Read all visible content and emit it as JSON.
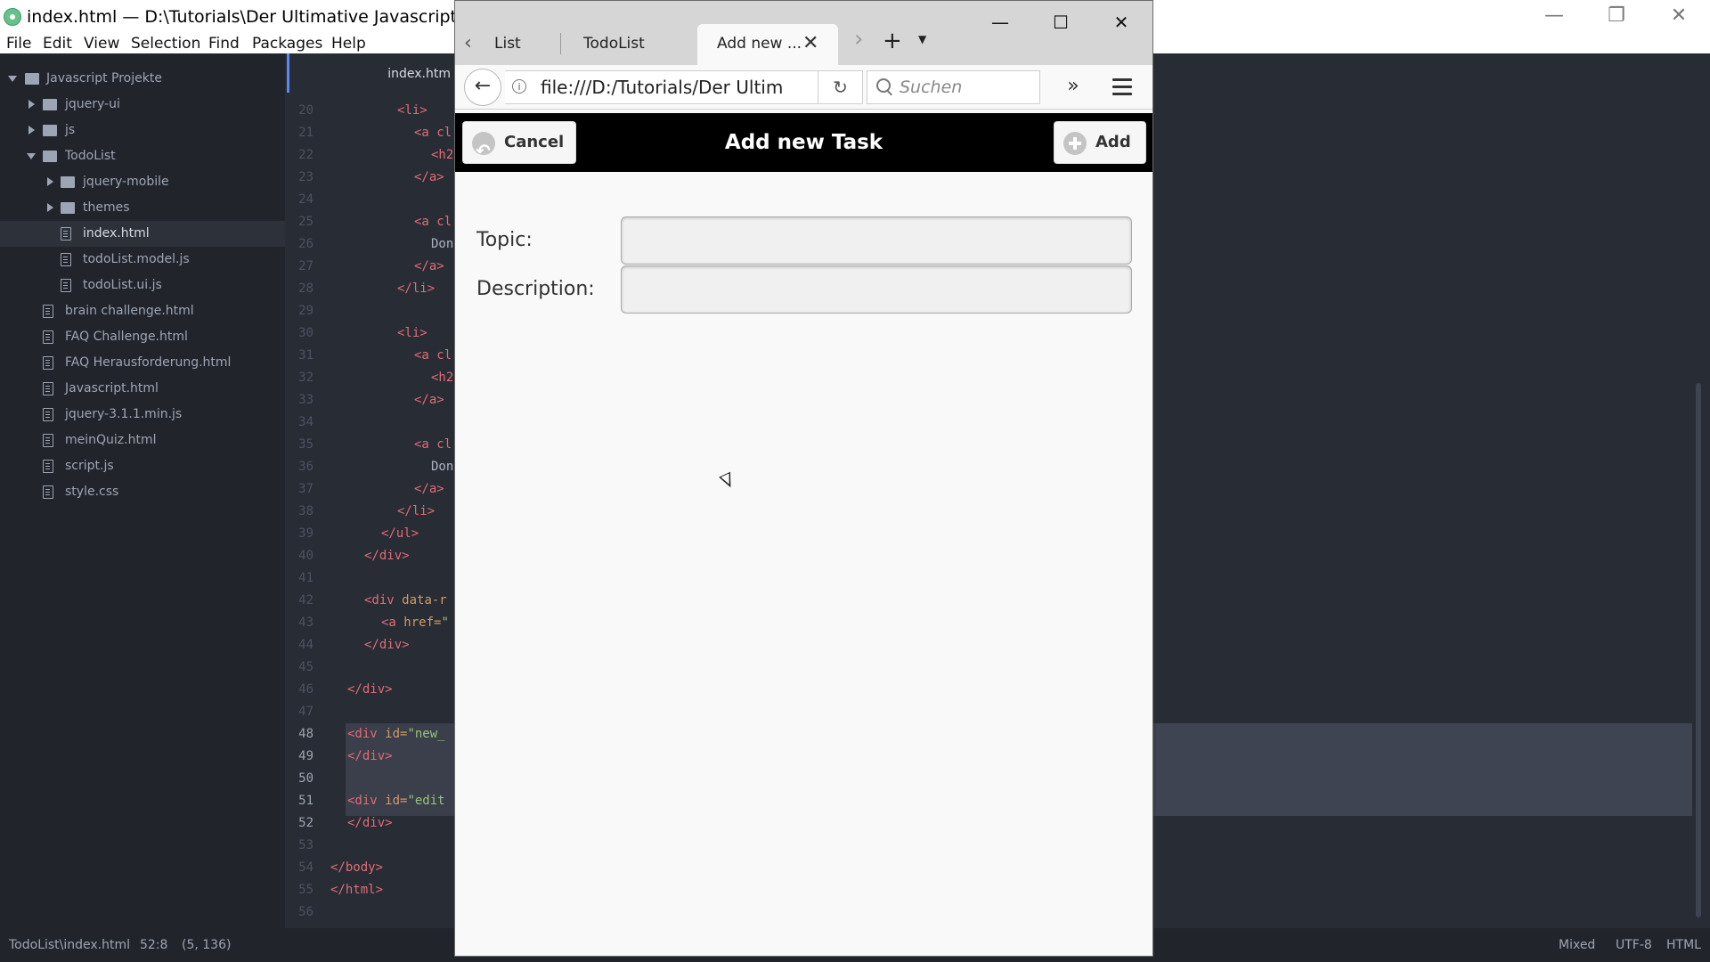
{
  "atom": {
    "title": "index.html — D:\\Tutorials\\Der Ultimative Javascript und jQue",
    "menu": [
      "File",
      "Edit",
      "View",
      "Selection",
      "Find",
      "Packages",
      "Help"
    ],
    "tree": {
      "root": "Javascript Projekte",
      "items": [
        {
          "label": "jquery-ui",
          "kind": "folder"
        },
        {
          "label": "js",
          "kind": "folder"
        },
        {
          "label": "TodoList",
          "kind": "folder-open"
        },
        {
          "label": "jquery-mobile",
          "kind": "folder"
        },
        {
          "label": "themes",
          "kind": "folder"
        },
        {
          "label": "index.html",
          "kind": "file",
          "selected": true
        },
        {
          "label": "todoList.model.js",
          "kind": "file"
        },
        {
          "label": "todoList.ui.js",
          "kind": "file"
        },
        {
          "label": "brain challenge.html",
          "kind": "file"
        },
        {
          "label": "FAQ Challenge.html",
          "kind": "file"
        },
        {
          "label": "FAQ Herausforderung.html",
          "kind": "file"
        },
        {
          "label": "Javascript.html",
          "kind": "file"
        },
        {
          "label": "jquery-3.1.1.min.js",
          "kind": "file"
        },
        {
          "label": "meinQuiz.html",
          "kind": "file"
        },
        {
          "label": "script.js",
          "kind": "file"
        },
        {
          "label": "style.css",
          "kind": "file"
        }
      ]
    },
    "editor_tab": "index.htm",
    "line_numbers": [
      "20",
      "21",
      "22",
      "23",
      "24",
      "25",
      "26",
      "27",
      "28",
      "29",
      "30",
      "31",
      "32",
      "33",
      "34",
      "35",
      "36",
      "37",
      "38",
      "39",
      "40",
      "41",
      "42",
      "43",
      "44",
      "45",
      "46",
      "47",
      "48",
      "49",
      "50",
      "51",
      "52",
      "53",
      "54",
      "55",
      "56"
    ],
    "code": {
      "l20": "<li>",
      "l21": "<a cl",
      "l22": "<h2",
      "l23": "</a>",
      "l25": "<a cl",
      "l26": "Don",
      "l27": "</a>",
      "l28": "</li>",
      "l30": "<li>",
      "l31": "<a cl",
      "l32": "<h2",
      "l33": "</a>",
      "l35": "<a cl",
      "l36": "Don",
      "l37": "</a>",
      "l38": "</li>",
      "l39": "</ul>",
      "l40": "</div>",
      "l42a": "<div ",
      "l42b": "data-r",
      "l43a": "<a ",
      "l43b": "href=",
      "l43c": "\"",
      "l44": "</div>",
      "l46": "</div>",
      "l48a": "<div ",
      "l48b": "id=",
      "l48c": "\"new_",
      "l49": "</div>",
      "l51a": "<div ",
      "l51b": "id=",
      "l51c": "\"edit",
      "l52": "</div>",
      "l54": "</body>",
      "l55": "</html>"
    },
    "status": {
      "path": "TodoList\\index.html",
      "cursor": "52:8",
      "selection": "(5, 136)",
      "line_ending": "Mixed",
      "encoding": "UTF-8",
      "grammar": "HTML"
    }
  },
  "browser": {
    "tabs": [
      "List",
      "TodoList",
      "Add new ..."
    ],
    "url": "file:///D:/Tutorials/Der Ultim",
    "search_placeholder": "Suchen",
    "page": {
      "title": "Add new Task",
      "cancel_label": "Cancel",
      "add_label": "Add",
      "topic_label": "Topic:",
      "description_label": "Description:",
      "topic_value": "",
      "description_value": ""
    }
  },
  "colors": {
    "editor_bg": "#282c34",
    "tree_bg": "#21252b",
    "accent": "#568af2",
    "jqm_header": "#000000"
  }
}
